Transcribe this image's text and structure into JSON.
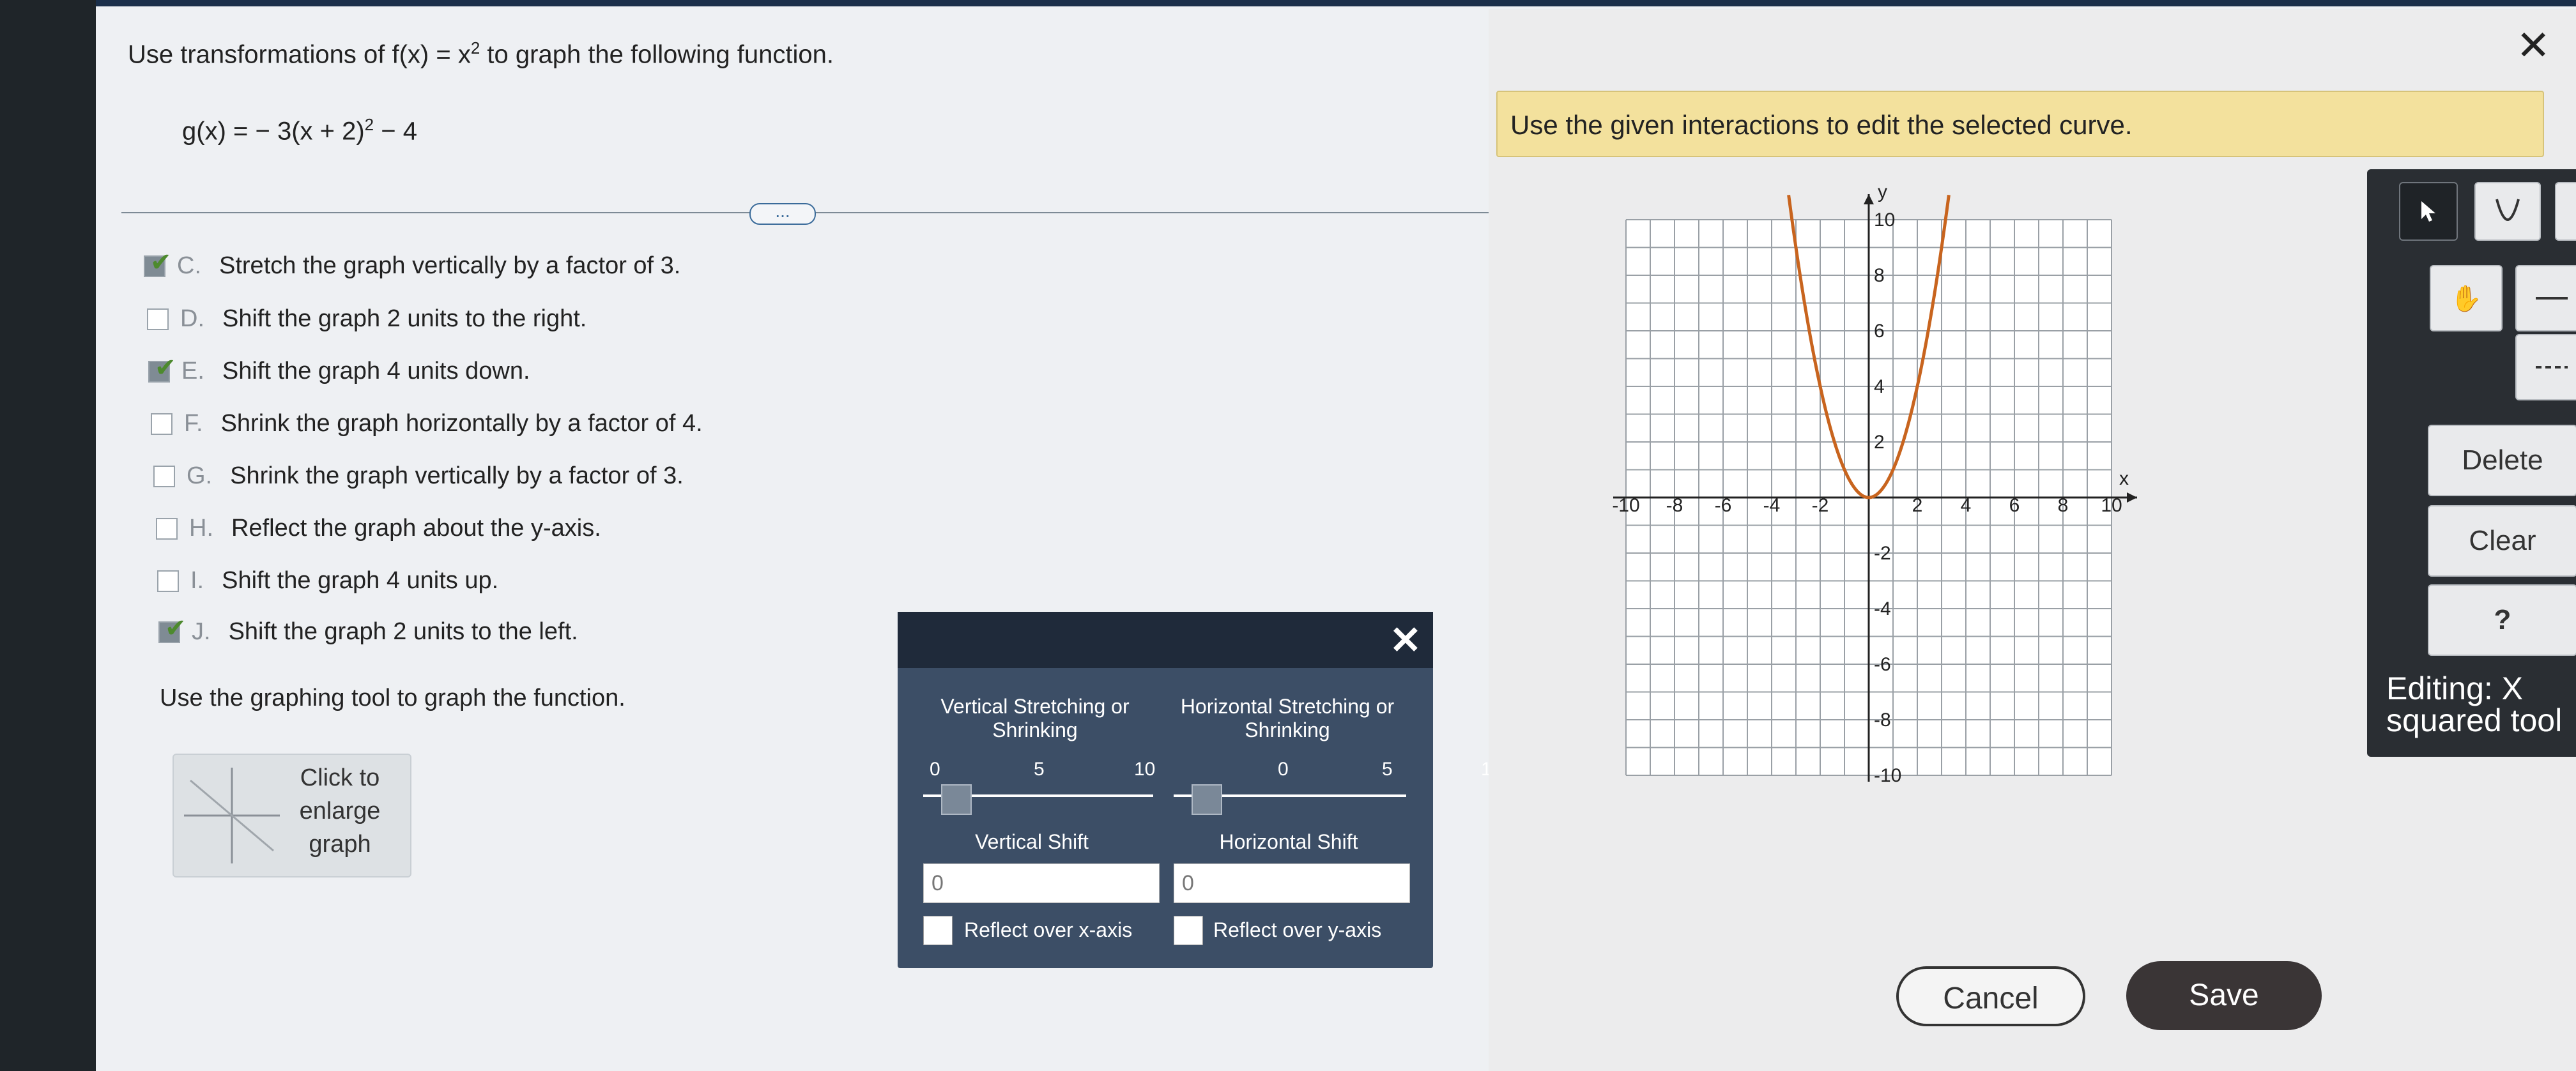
{
  "question": {
    "prefix": "Use transformations of f(x) = x",
    "exp": "2",
    "suffix": " to graph the following function."
  },
  "function": {
    "text": "g(x) = − 3(x + 2)",
    "exp": "2",
    "tail": " − 4"
  },
  "options": [
    {
      "letter": "C.",
      "text": "Stretch the graph vertically by a factor of 3.",
      "checked": true
    },
    {
      "letter": "D.",
      "text": "Shift the graph 2 units to the right.",
      "checked": false
    },
    {
      "letter": "E.",
      "text": "Shift the graph 4 units down.",
      "checked": true
    },
    {
      "letter": "F.",
      "text": "Shrink the graph horizontally by a factor of 4.",
      "checked": false
    },
    {
      "letter": "G.",
      "text": "Shrink the graph vertically by a factor of 3.",
      "checked": false
    },
    {
      "letter": "H.",
      "text": "Reflect the graph about the y-axis.",
      "checked": false
    },
    {
      "letter": "I.",
      "text": "Shift the graph 4 units up.",
      "checked": false
    },
    {
      "letter": "J.",
      "text": "Shift the graph 2 units to the left.",
      "checked": true
    }
  ],
  "instruction2": "Use the graphing tool to graph the function.",
  "enlarge_label": "Click to enlarge graph",
  "dots": "...",
  "dialog": {
    "close": "✕",
    "vertical_stretch_label": "Vertical Stretching or Shrinking",
    "horizontal_stretch_label": "Horizontal Stretching or Shrinking",
    "ticks": [
      "0",
      "5",
      "10"
    ],
    "vertical_shift_label": "Vertical Shift",
    "horizontal_shift_label": "Horizontal Shift",
    "vertical_shift_value": "0",
    "horizontal_shift_value": "0",
    "reflect_x": "Reflect over x-axis",
    "reflect_y": "Reflect over y-axis"
  },
  "right_panel": {
    "close": "✕",
    "banner": "Use the given interactions to edit the selected curve.",
    "graph": {
      "x_range": [
        -10,
        10
      ],
      "y_range": [
        -10,
        10
      ],
      "x_ticks": [
        "-10",
        "-8",
        "-6",
        "-4",
        "-2",
        "2",
        "4",
        "6",
        "8",
        "10"
      ],
      "y_ticks": [
        "10",
        "8",
        "6",
        "4",
        "2",
        "-2",
        "-4",
        "-6",
        "-8",
        "-10"
      ],
      "x_label": "x",
      "y_label": "y",
      "curve_color": "#c8641e"
    },
    "tools": {
      "delete": "Delete",
      "clear": "Clear",
      "help": "?",
      "editing": "Editing: X squared tool"
    }
  },
  "buttons": {
    "cancel": "Cancel",
    "save": "Save"
  }
}
